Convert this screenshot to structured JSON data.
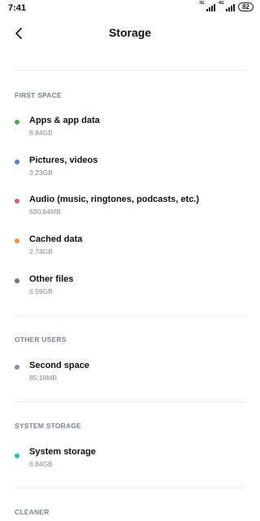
{
  "status_bar": {
    "time": "7:41",
    "network_1": "3G",
    "network_2": "4G",
    "battery": "82"
  },
  "header": {
    "title": "Storage"
  },
  "sections": [
    {
      "title": "FIRST SPACE",
      "items": [
        {
          "label": "Apps & app data",
          "size": "8.84GB",
          "color": "#3cb043"
        },
        {
          "label": "Pictures, videos",
          "size": "3.23GB",
          "color": "#4f7fe0"
        },
        {
          "label": "Audio (music, ringtones, podcasts, etc.)",
          "size": "630.64MB",
          "color": "#e0577b"
        },
        {
          "label": "Cached data",
          "size": "2.74GB",
          "color": "#f0953a"
        },
        {
          "label": "Other files",
          "size": "6.59GB",
          "color": "#5e7d6e"
        }
      ]
    },
    {
      "title": "OTHER USERS",
      "items": [
        {
          "label": "Second space",
          "size": "85.18MB",
          "color": "#9a7fc0"
        }
      ]
    },
    {
      "title": "SYSTEM STORAGE",
      "items": [
        {
          "label": "System storage",
          "size": "6.84GB",
          "color": "#1fc1cf"
        }
      ]
    },
    {
      "title": "CLEANER",
      "items": []
    }
  ]
}
